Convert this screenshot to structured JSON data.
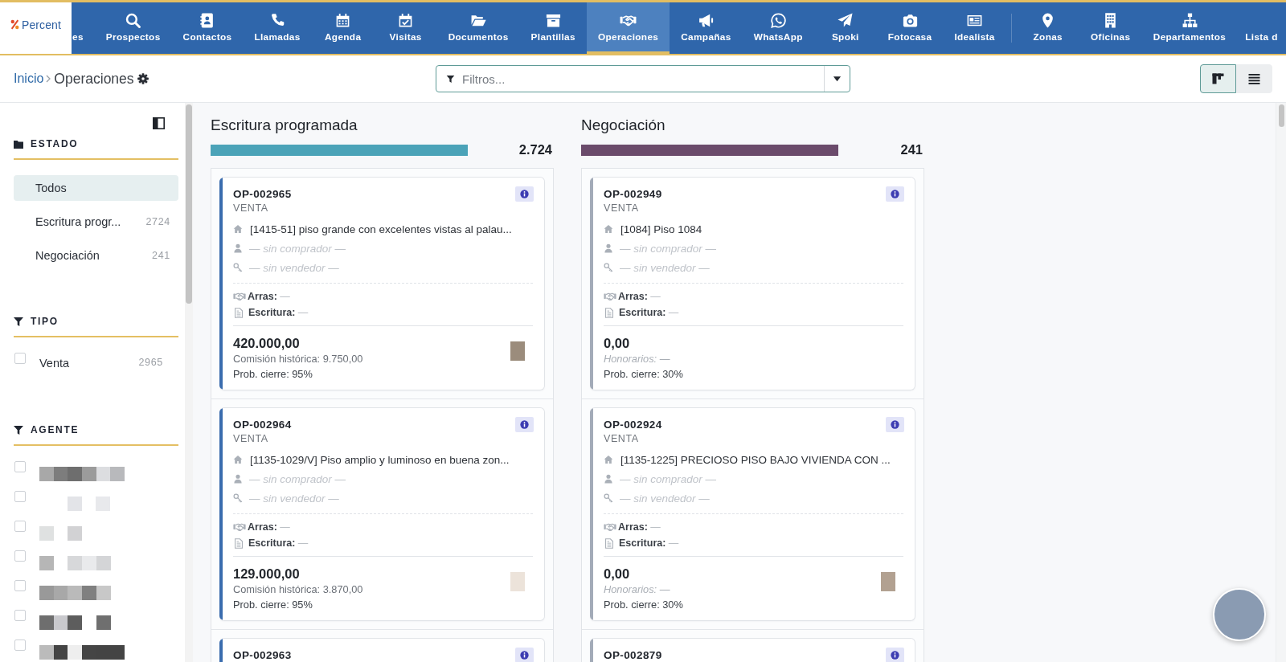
{
  "top_nav": {
    "logo": "Percent",
    "groups": [
      {
        "items": [
          {
            "label": "es",
            "selected": false
          },
          {
            "label": "Prospectos",
            "selected": false
          },
          {
            "label": "Contactos",
            "selected": false
          },
          {
            "label": "Llamadas",
            "selected": false
          },
          {
            "label": "Agenda",
            "selected": false
          },
          {
            "label": "Visitas",
            "selected": false
          },
          {
            "label": "Documentos",
            "selected": false
          },
          {
            "label": "Plantillas",
            "selected": false
          },
          {
            "label": "Operaciones",
            "selected": true
          },
          {
            "label": "Campañas",
            "selected": false
          },
          {
            "label": "WhatsApp",
            "selected": false
          },
          {
            "label": "Spoki",
            "selected": false
          },
          {
            "label": "Fotocasa",
            "selected": false
          },
          {
            "label": "Idealista",
            "selected": false
          }
        ]
      },
      {
        "items": [
          {
            "label": "Zonas",
            "selected": false
          },
          {
            "label": "Oficinas",
            "selected": false
          },
          {
            "label": "Departamentos",
            "selected": false
          },
          {
            "label": "Lista d",
            "selected": false
          }
        ]
      }
    ]
  },
  "toolbar": {
    "breadcrumb": [
      "Inicio",
      "Operaciones"
    ],
    "filter": {
      "placeholder": "Filtros..."
    },
    "views": [
      {
        "kind": "board",
        "selected": true
      },
      {
        "kind": "list",
        "selected": false
      }
    ]
  },
  "sidebar": {
    "sections": [
      {
        "kind": "list",
        "title": "ESTADO",
        "items": [
          {
            "label": "Todos",
            "selected": true
          },
          {
            "label": "Escritura progr...",
            "count": "2724",
            "selected": false
          },
          {
            "label": "Negociación",
            "count": "241",
            "selected": false
          }
        ]
      },
      {
        "kind": "checklist",
        "title": "TIPO",
        "items": [
          {
            "label": "Venta",
            "count": "2965",
            "checked": false
          }
        ]
      },
      {
        "kind": "checklist",
        "title": "AGENTE",
        "items": [
          {
            "checked": false
          },
          {
            "checked": false
          },
          {
            "checked": false
          },
          {
            "checked": false
          },
          {
            "checked": false
          },
          {
            "checked": false
          },
          {
            "checked": false
          }
        ]
      }
    ]
  },
  "board": {
    "columns": [
      {
        "title": "Escritura programada",
        "count": "2.724",
        "color": "#4ba3b8",
        "cards": [
          {
            "code": "OP-002965",
            "type": "VENTA",
            "color": "#3a6cae",
            "property": "[1415-51] piso grande con excelentes vistas al palau...",
            "buyer": "— sin comprador —",
            "seller": "— sin vendedor —",
            "details": [
              {
                "text": "**Arras:** —"
              },
              {
                "text": "**Escritura:** —"
              }
            ],
            "amount": "420.000,00",
            "fee": {
              "text": "Comisión histórica: 9.750,00",
              "muted": false
            },
            "probability": "Prob. cierre: 95%",
            "photo": {
              "color": "#9b8c7c"
            }
          },
          {
            "code": "OP-002964",
            "type": "VENTA",
            "color": "#3a6cae",
            "property": "[1135-1029/V] Piso amplio y luminoso en buena zon...",
            "buyer": "— sin comprador —",
            "seller": "— sin vendedor —",
            "details": [
              {
                "text": "**Arras:** —"
              },
              {
                "text": "**Escritura:** —"
              }
            ],
            "amount": "129.000,00",
            "fee": {
              "text": "Comisión histórica: 3.870,00",
              "muted": false
            },
            "probability": "Prob. cierre: 95%",
            "photo": {
              "color": "#ece3da"
            }
          },
          {
            "code": "OP-002963",
            "color": "#3a6cae"
          }
        ]
      },
      {
        "title": "Negociación",
        "count": "241",
        "color": "#6b4b6b",
        "cards": [
          {
            "code": "OP-002949",
            "type": "VENTA",
            "color": "#a3abb8",
            "property": "[1084] Piso 1084",
            "buyer": "— sin comprador —",
            "seller": "— sin vendedor —",
            "details": [
              {
                "text": "**Arras:** —"
              },
              {
                "text": "**Escritura:** —"
              }
            ],
            "amount": "0,00",
            "fee": {
              "text": "Honorarios: —",
              "muted": true
            },
            "probability": "Prob. cierre: 30%"
          },
          {
            "code": "OP-002924",
            "type": "VENTA",
            "color": "#a3abb8",
            "property": "[1135-1225] PRECIOSO PISO BAJO VIVIENDA CON ...",
            "buyer": "— sin comprador —",
            "seller": "— sin vendedor —",
            "details": [
              {
                "text": "**Arras:** —"
              },
              {
                "text": "**Escritura:** —"
              }
            ],
            "amount": "0,00",
            "fee": {
              "text": "Honorarios: —",
              "muted": true
            },
            "probability": "Prob. cierre: 30%",
            "photo": {
              "color": "#b2a191"
            }
          },
          {
            "code": "OP-002879",
            "color": "#a3abb8"
          }
        ]
      }
    ]
  }
}
